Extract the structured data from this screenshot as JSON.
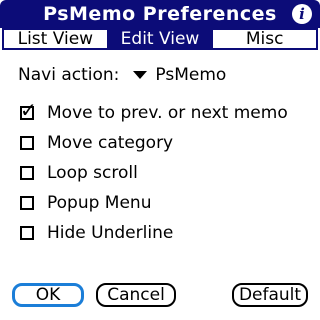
{
  "window": {
    "title": "PsMemo Preferences",
    "info_icon": "info-icon"
  },
  "tabs": [
    {
      "label": "List View",
      "active": false
    },
    {
      "label": "Edit View",
      "active": true
    },
    {
      "label": "Misc",
      "active": false
    }
  ],
  "navi": {
    "label": "Navi action:",
    "value": "PsMemo"
  },
  "options": [
    {
      "label": "Move to prev. or next memo",
      "checked": true,
      "mark": "✓"
    },
    {
      "label": "Move category",
      "checked": false
    },
    {
      "label": "Loop scroll",
      "checked": false
    },
    {
      "label": "Popup Menu",
      "checked": false
    },
    {
      "label": "Hide Underline",
      "checked": false
    }
  ],
  "buttons": {
    "ok": "OK",
    "cancel": "Cancel",
    "default": "Default"
  },
  "colors": {
    "titlebar": "#0c0c78",
    "focus": "#1b7ed8"
  }
}
